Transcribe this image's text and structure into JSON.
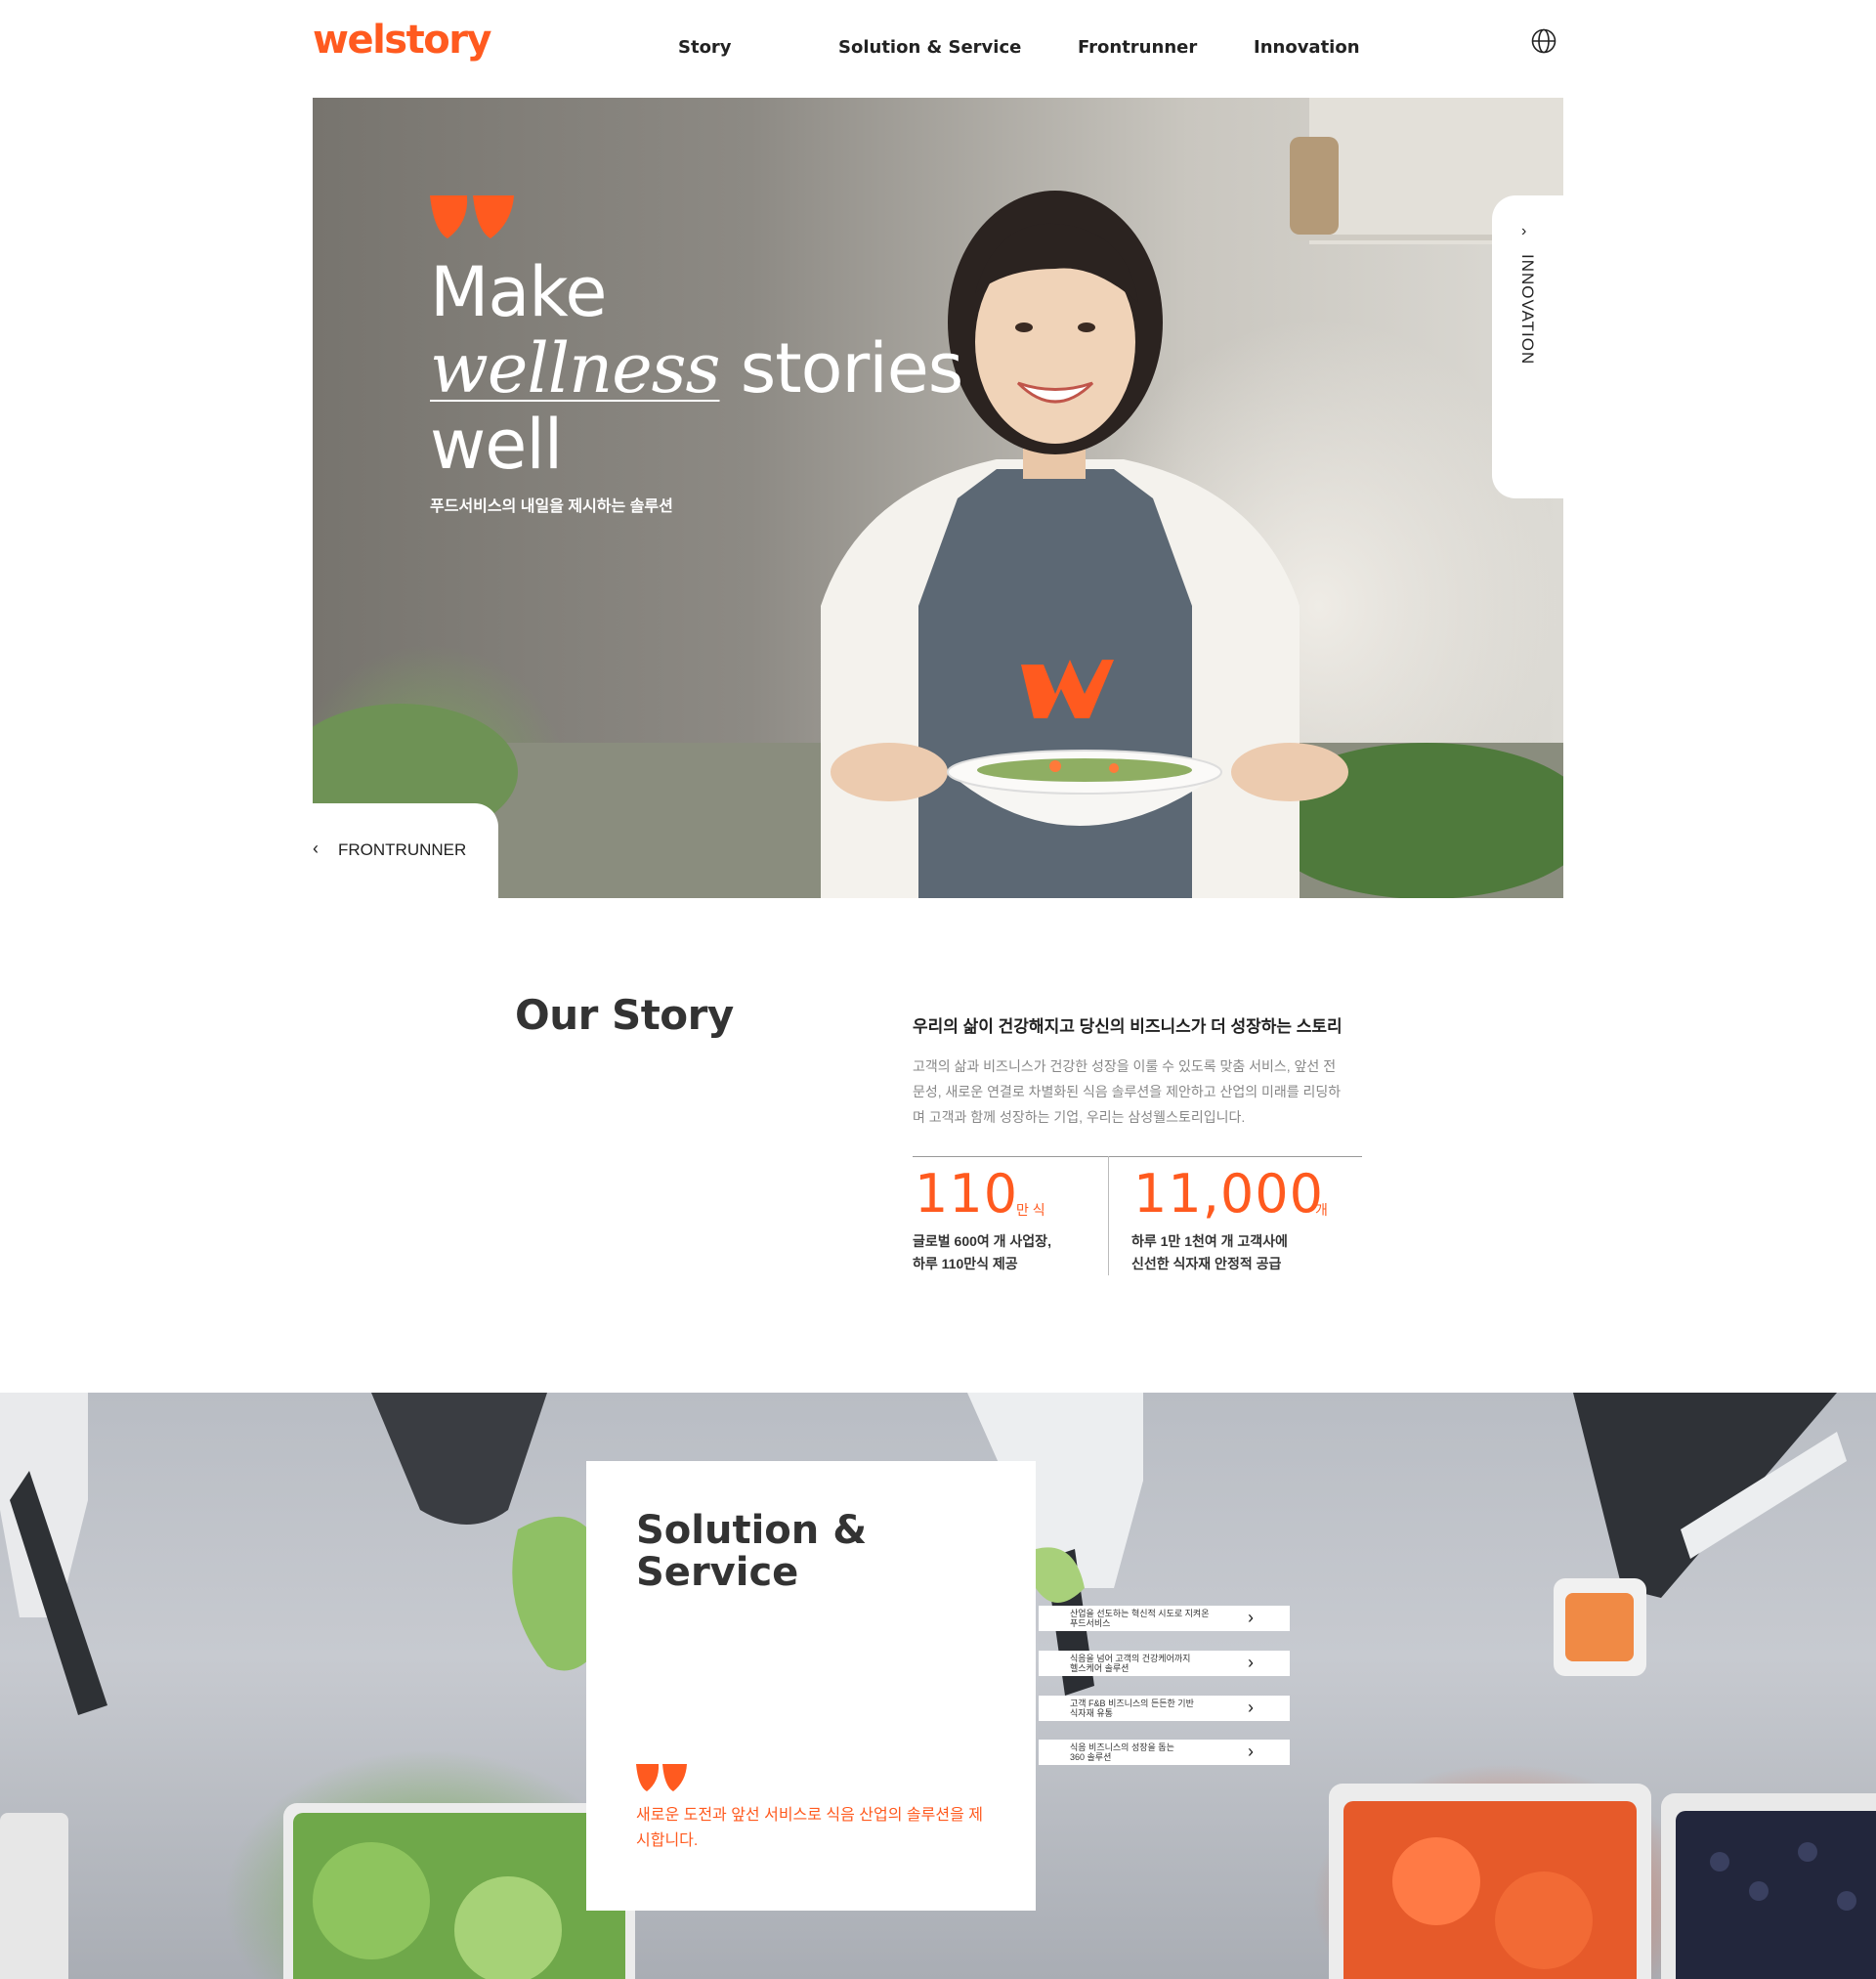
{
  "colors": {
    "accent": "#ff5a1f",
    "text": "#222222",
    "muted": "#888888"
  },
  "header": {
    "logo": "welstory",
    "nav": [
      "Story",
      "Solution & Service",
      "Frontrunner",
      "Innovation"
    ],
    "globe_icon": "globe-icon"
  },
  "hero": {
    "quote_icon": "quote-mark-icon",
    "title_line1": "Make",
    "title_em": "wellness",
    "title_line2_rest": " stories",
    "title_line3": "well",
    "subtitle": "푸드서비스의 내일을 제시하는 솔루션",
    "side_tab": {
      "label": "INNOVATION",
      "icon": "chevron-right-icon"
    },
    "bottom_tab": {
      "label": "FRONTRUNNER",
      "icon": "chevron-left-icon"
    }
  },
  "story": {
    "title": "Our Story",
    "heading": "우리의 삶이 건강해지고 당신의 비즈니스가 더 성장하는 스토리",
    "body": "고객의 삶과 비즈니스가 건강한 성장을 이룰 수 있도록 맞춤 서비스, 앞선 전문성, 새로운 연결로 차별화된 식음 솔루션을 제안하고 산업의 미래를 리딩하며 고객과 함께 성장하는 기업, 우리는 삼성웰스토리입니다.",
    "stats": [
      {
        "value": "110",
        "unit": "만 식",
        "desc_line1": "글로벌 600여 개 사업장,",
        "desc_line2": "하루 110만식 제공"
      },
      {
        "value": "11,000",
        "unit": "개",
        "desc_line1": "하루 1만 1천여 개 고객사에",
        "desc_line2": "신선한 식자재 안정적 공급"
      }
    ]
  },
  "solution": {
    "title_line1": "Solution &",
    "title_line2": "Service",
    "subtitle": "새로운 도전과 앞선 서비스로 식음 산업의 솔루션을 제시합니다.",
    "links": [
      {
        "line1": "산업을 선도하는 혁신적 시도로 지켜온",
        "line2": "푸드서비스"
      },
      {
        "line1": "식음을 넘어 고객의 건강케어까지",
        "line2": "헬스케어 솔루션"
      },
      {
        "line1": "고객 F&B 비즈니스의 든든한 기반",
        "line2": "식자재 유통"
      },
      {
        "line1": "식음 비즈니스의 성장을 돕는",
        "line2": "360 솔루션"
      }
    ]
  }
}
